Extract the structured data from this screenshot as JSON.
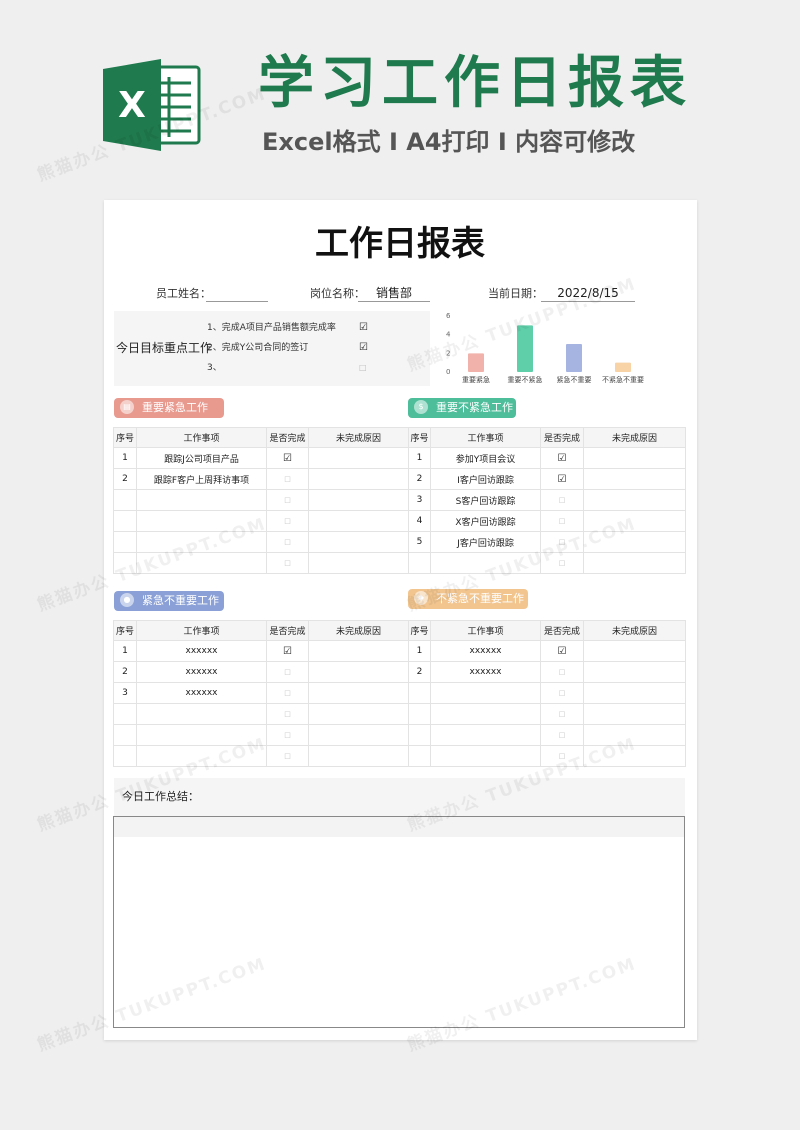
{
  "header": {
    "title": "学习工作日报表",
    "subtitle": "Excel格式 I A4打印 I 内容可修改",
    "logo_letter": "X"
  },
  "document": {
    "title": "工作日报表",
    "employee_label": "员工姓名：",
    "employee_value": "",
    "position_label": "岗位名称：",
    "position_value": "销售部",
    "date_label": "当前日期：",
    "date_value": "2022/8/15"
  },
  "goals": {
    "heading": "今日目标重点工作",
    "items": [
      {
        "text": "1、完成A项目产品销售额完成率",
        "check": "☑"
      },
      {
        "text": "2、完成Y公司合同的签订",
        "check": "☑"
      },
      {
        "text": "3、",
        "check": "□"
      }
    ]
  },
  "chart_data": {
    "type": "bar",
    "categories": [
      "重要紧急",
      "重要不紧急",
      "紧急不重要",
      "不紧急不重要"
    ],
    "values": [
      2,
      5,
      3,
      1
    ],
    "ylim": [
      0,
      6
    ],
    "yticks": [
      "0",
      "2",
      "4",
      "6"
    ],
    "colors": [
      "#f0b2aa",
      "#5fcfa9",
      "#a6b4e2",
      "#f7d3a6"
    ],
    "grid": false
  },
  "sections": {
    "important_urgent": {
      "label": "重要紧急工作",
      "icon": "clipboard-icon",
      "headers": [
        "序号",
        "工作事项",
        "是否完成",
        "未完成原因"
      ],
      "rows": [
        [
          "1",
          "跟踪J公司项目产品",
          "☑",
          ""
        ],
        [
          "2",
          "跟踪F客户上周拜访事项",
          "□",
          ""
        ],
        [
          "",
          "",
          "□",
          ""
        ],
        [
          "",
          "",
          "□",
          ""
        ],
        [
          "",
          "",
          "□",
          ""
        ],
        [
          "",
          "",
          "□",
          ""
        ]
      ]
    },
    "important_not_urgent": {
      "label": "重要不紧急工作",
      "icon": "dollar-icon",
      "headers": [
        "序号",
        "工作事项",
        "是否完成",
        "未完成原因"
      ],
      "rows": [
        [
          "1",
          "参加Y项目会议",
          "☑",
          ""
        ],
        [
          "2",
          "I客户回访跟踪",
          "☑",
          ""
        ],
        [
          "3",
          "S客户回访跟踪",
          "□",
          ""
        ],
        [
          "4",
          "X客户回访跟踪",
          "□",
          ""
        ],
        [
          "5",
          "J客户回访跟踪",
          "□",
          ""
        ],
        [
          "",
          "",
          "□",
          ""
        ]
      ]
    },
    "urgent_not_important": {
      "label": "紧急不重要工作",
      "icon": "people-icon",
      "headers": [
        "序号",
        "工作事项",
        "是否完成",
        "未完成原因"
      ],
      "rows": [
        [
          "1",
          "xxxxxx",
          "☑",
          ""
        ],
        [
          "2",
          "xxxxxx",
          "□",
          ""
        ],
        [
          "3",
          "xxxxxx",
          "□",
          ""
        ],
        [
          "",
          "",
          "□",
          ""
        ],
        [
          "",
          "",
          "□",
          ""
        ],
        [
          "",
          "",
          "□",
          ""
        ]
      ]
    },
    "not_urgent_not_important": {
      "label": "不紧急不重要工作",
      "icon": "tag-icon",
      "headers": [
        "序号",
        "工作事项",
        "是否完成",
        "未完成原因"
      ],
      "rows": [
        [
          "1",
          "xxxxxx",
          "☑",
          ""
        ],
        [
          "2",
          "xxxxxx",
          "□",
          ""
        ],
        [
          "",
          "",
          "□",
          ""
        ],
        [
          "",
          "",
          "□",
          ""
        ],
        [
          "",
          "",
          "□",
          ""
        ],
        [
          "",
          "",
          "□",
          ""
        ]
      ]
    }
  },
  "summary": {
    "label": "今日工作总结：",
    "content": ""
  },
  "watermark": {
    "text": "熊猫办公 TUKUPPT.COM"
  }
}
